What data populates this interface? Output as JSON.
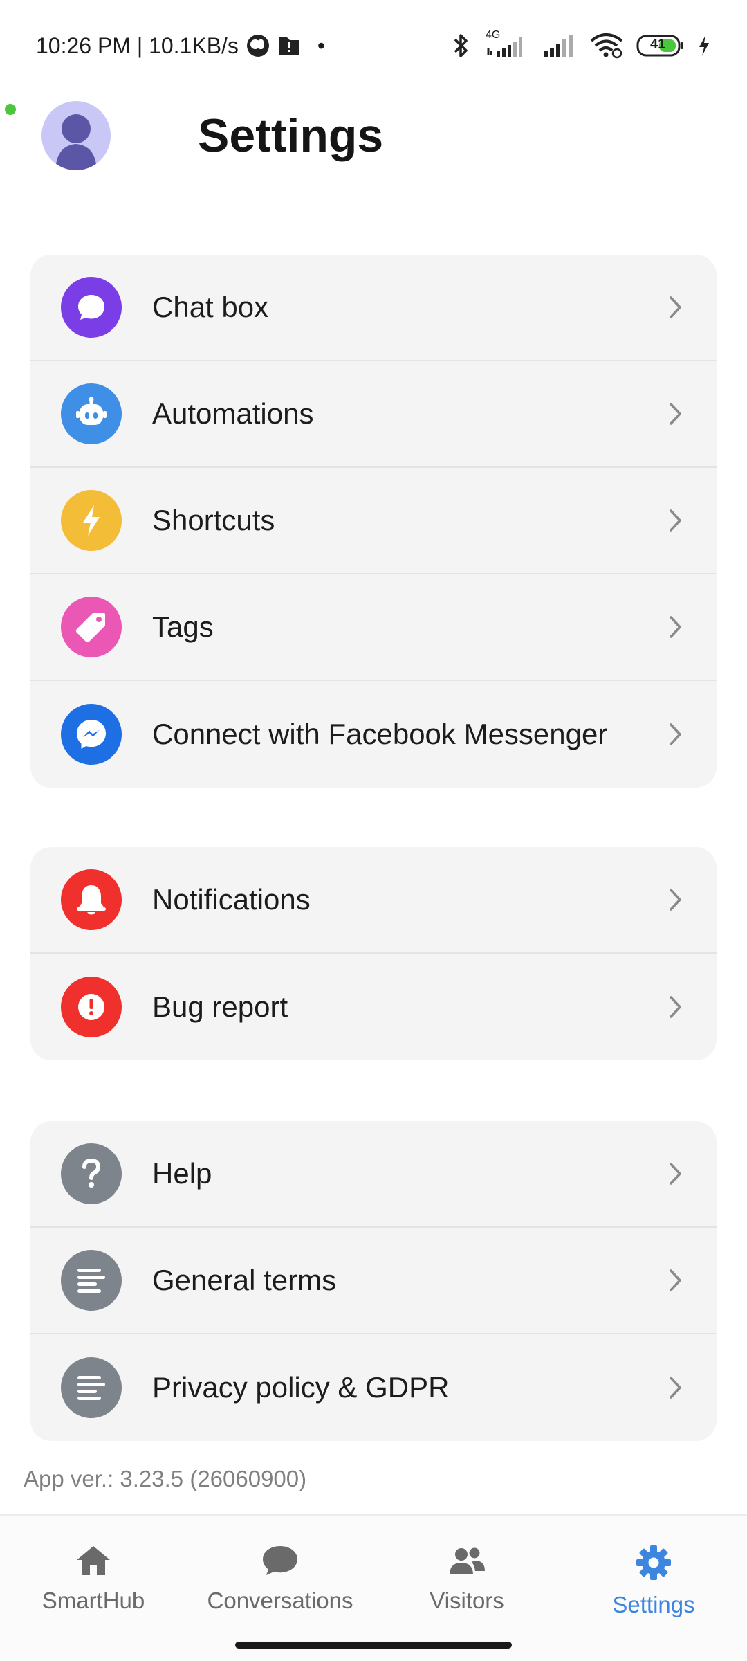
{
  "status_bar": {
    "time_speed": "10:26 PM | 10.1KB/s",
    "dot": "•",
    "network": "4G",
    "battery": "41"
  },
  "header": {
    "title": "Settings"
  },
  "groups": [
    {
      "items": [
        {
          "label": "Chat box",
          "icon": "chat-bubble-icon",
          "color": "#7b3ee6"
        },
        {
          "label": "Automations",
          "icon": "robot-icon",
          "color": "#3f8fe6"
        },
        {
          "label": "Shortcuts",
          "icon": "lightning-icon",
          "color": "#f3bd37"
        },
        {
          "label": "Tags",
          "icon": "tag-icon",
          "color": "#ea57b4"
        },
        {
          "label": "Connect with Facebook Messenger",
          "icon": "messenger-icon",
          "color": "#1d6fe3"
        }
      ]
    },
    {
      "items": [
        {
          "label": "Notifications",
          "icon": "bell-icon",
          "color": "#f0302d"
        },
        {
          "label": "Bug report",
          "icon": "alert-icon",
          "color": "#f0302d"
        }
      ]
    },
    {
      "items": [
        {
          "label": "Help",
          "icon": "question-icon",
          "color": "#7d848c"
        },
        {
          "label": "General terms",
          "icon": "document-lines-icon",
          "color": "#7d848c"
        },
        {
          "label": "Privacy policy & GDPR",
          "icon": "document-lines-icon",
          "color": "#7d848c"
        }
      ]
    }
  ],
  "app_version": "App ver.: 3.23.5 (26060900)",
  "bottom_nav": {
    "items": [
      {
        "label": "SmartHub",
        "icon": "home-icon"
      },
      {
        "label": "Conversations",
        "icon": "chat-icon"
      },
      {
        "label": "Visitors",
        "icon": "people-icon"
      },
      {
        "label": "Settings",
        "icon": "gear-icon"
      }
    ],
    "active": "Settings",
    "active_color": "#3d86e0",
    "inactive_color": "#6a6a6a"
  }
}
